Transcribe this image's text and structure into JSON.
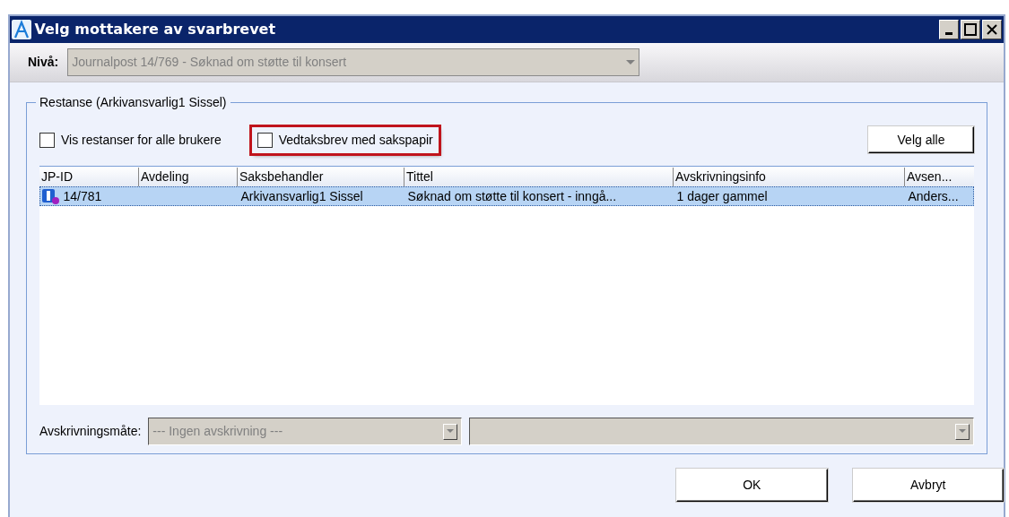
{
  "window": {
    "title": "Velg mottakere av svarbrevet"
  },
  "level_bar": {
    "label": "Nivå:",
    "value": "Journalpost 14/769 - Søknad om støtte til konsert",
    "disabled": true
  },
  "group": {
    "title": "Restanse (Arkivansvarlig1 Sissel)",
    "checkboxes": [
      {
        "label": "Vis restanser for alle brukere",
        "checked": false,
        "highlighted": false
      },
      {
        "label": "Vedtaksbrev med sakspapir",
        "checked": false,
        "highlighted": true
      }
    ],
    "select_all_button": "Velg alle",
    "table": {
      "columns": [
        "JP-ID",
        "Avdeling",
        "Saksbehandler",
        "Tittel",
        "Avskrivningsinfo",
        "Avsen..."
      ],
      "rows": [
        {
          "selected": true,
          "cells": [
            "14/781",
            "",
            "Arkivansvarlig1 Sissel",
            "Søknad om støtte til konsert - inngå...",
            "1 dager gammel",
            "Anders..."
          ]
        }
      ]
    },
    "write_off": {
      "label": "Avskrivningsmåte:",
      "value": "--- Ingen avskrivning ---",
      "disabled": true
    }
  },
  "buttons": [
    "OK",
    "Avbryt"
  ]
}
